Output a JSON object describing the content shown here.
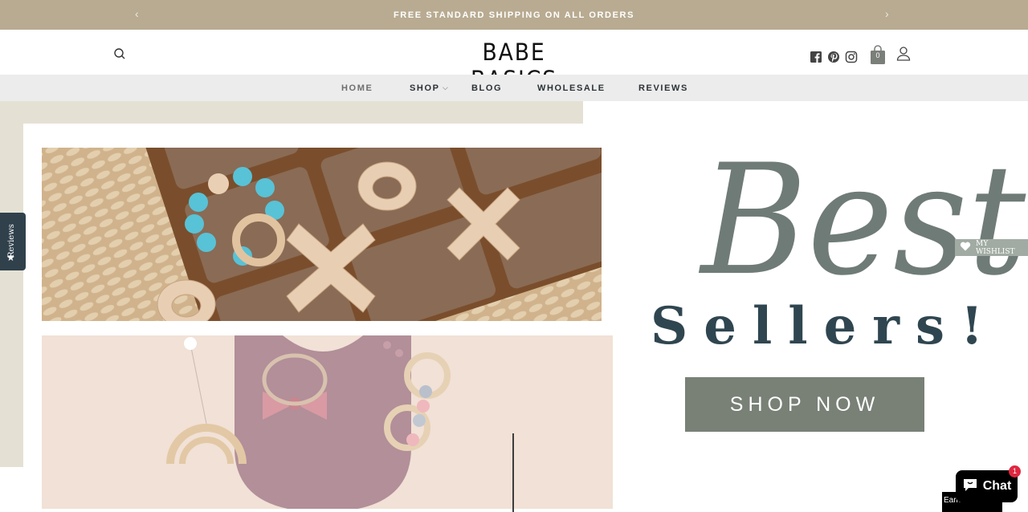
{
  "announcement": {
    "text": "FREE STANDARD SHIPPING ON ALL ORDERS",
    "prev_arrow": "‹",
    "next_arrow": "›"
  },
  "header": {
    "logo": "BABE BASICS",
    "cart_count": "0",
    "icons": [
      "search-icon",
      "facebook-icon",
      "pinterest-icon",
      "instagram-icon",
      "cart-icon",
      "account-icon"
    ]
  },
  "nav": {
    "items": [
      {
        "label": "HOME",
        "active": true
      },
      {
        "label": "SHOP",
        "has_dropdown": true
      },
      {
        "label": "BLOG"
      },
      {
        "label": "WHOLESALE"
      },
      {
        "label": "REVIEWS"
      }
    ]
  },
  "hero": {
    "script_word": "Best",
    "headline": "Sellers!",
    "cta_label": "SHOP NOW"
  },
  "widgets": {
    "reviews_tab": "Reviews",
    "wishlist": "MY WISHLIST",
    "chat_label": "Chat",
    "chat_badge": "1",
    "earn_label": "Earn"
  },
  "colors": {
    "announcement_bg": "#b8ab91",
    "nav_bg": "#ececec",
    "cta_bg": "#798177",
    "headline": "#2f4650",
    "script": "#6f7b76",
    "reviews_tab_bg": "#30414c"
  }
}
